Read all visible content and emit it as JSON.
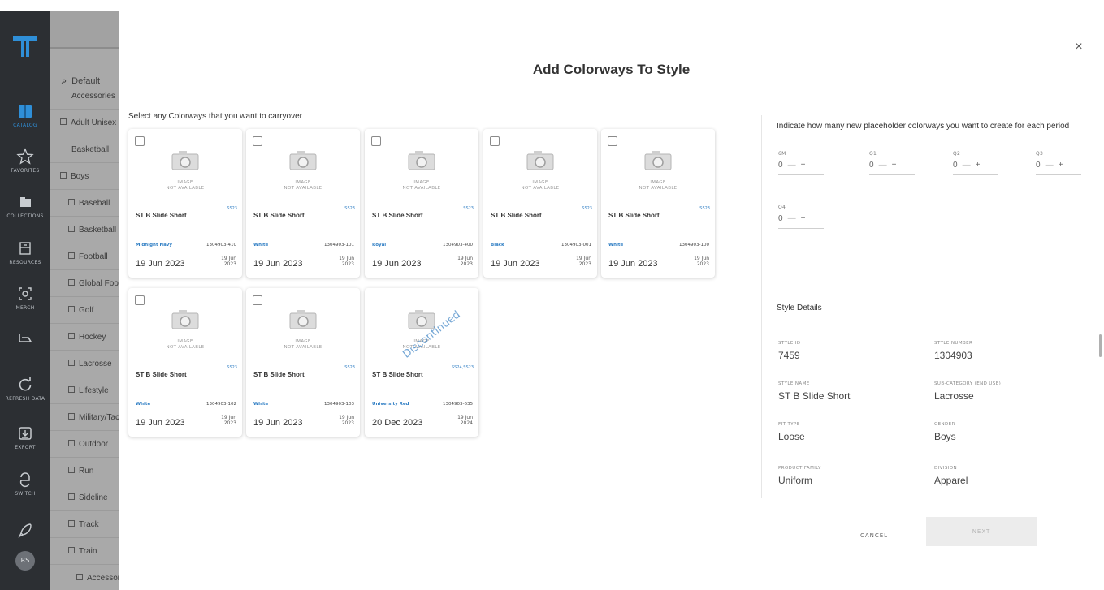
{
  "app": {
    "logo": "under-armour-style-logo"
  },
  "rail": {
    "items": [
      {
        "label": "CATALOG",
        "icon": "book-icon",
        "active": true
      },
      {
        "label": "FAVORITES",
        "icon": "star-icon"
      },
      {
        "label": "COLLECTIONS",
        "icon": "folder-icon"
      },
      {
        "label": "RESOURCES",
        "icon": "resources-icon"
      },
      {
        "label": "MERCH",
        "icon": "merch-icon"
      },
      {
        "label": "",
        "icon": "hanger-icon"
      },
      {
        "label": "REFRESH DATA",
        "icon": "refresh-icon"
      },
      {
        "label": "EXPORT",
        "icon": "export-icon"
      },
      {
        "label": "SWITCH",
        "icon": "switch-icon"
      },
      {
        "label": "",
        "icon": "rocket-icon"
      }
    ],
    "avatar": "RS",
    "accent": "#2f8fd8"
  },
  "category_panel": {
    "search_value": "Default",
    "items": [
      "Accessories",
      "Adult Unisex",
      "Basketball",
      "Boys",
      "Baseball",
      "Basketball",
      "Football",
      "Global Football",
      "Golf",
      "Hockey",
      "Lacrosse",
      "Lifestyle",
      "Military/Tactical",
      "Outdoor",
      "Run",
      "Sideline",
      "Track",
      "Train",
      "Accessories"
    ]
  },
  "dialog": {
    "title": "Add Colorways To Style",
    "instruction": "Select any Colorways that you want to carryover",
    "image_placeholder_line1": "IMAGE",
    "image_placeholder_line2": "NOT AVAILABLE",
    "cards": [
      {
        "name": "ST B Slide Short",
        "season": "SS23",
        "color": "Midnight Navy",
        "number": "1304903-410",
        "date": "19 Jun 2023",
        "small_date_1": "19 Jun",
        "small_date_2": "2023",
        "checked": false,
        "discontinued": false
      },
      {
        "name": "ST B Slide Short",
        "season": "SS23",
        "color": "White",
        "number": "1304903-101",
        "date": "19 Jun 2023",
        "small_date_1": "19 Jun",
        "small_date_2": "2023",
        "checked": false,
        "discontinued": false
      },
      {
        "name": "ST B Slide Short",
        "season": "SS23",
        "color": "Royal",
        "number": "1304903-400",
        "date": "19 Jun 2023",
        "small_date_1": "19 Jun",
        "small_date_2": "2023",
        "checked": false,
        "discontinued": false
      },
      {
        "name": "ST B Slide Short",
        "season": "SS23",
        "color": "Black",
        "number": "1304903-001",
        "date": "19 Jun 2023",
        "small_date_1": "19 Jun",
        "small_date_2": "2023",
        "checked": false,
        "discontinued": false
      },
      {
        "name": "ST B Slide Short",
        "season": "SS23",
        "color": "White",
        "number": "1304903-100",
        "date": "19 Jun 2023",
        "small_date_1": "19 Jun",
        "small_date_2": "2023",
        "checked": false,
        "discontinued": false
      },
      {
        "name": "ST B Slide Short",
        "season": "SS23",
        "color": "White",
        "number": "1304903-102",
        "date": "19 Jun 2023",
        "small_date_1": "19 Jun",
        "small_date_2": "2023",
        "checked": false,
        "discontinued": false
      },
      {
        "name": "ST B Slide Short",
        "season": "SS23",
        "color": "White",
        "number": "1304903-103",
        "date": "19 Jun 2023",
        "small_date_1": "19 Jun",
        "small_date_2": "2023",
        "checked": false,
        "discontinued": false
      },
      {
        "name": "ST B Slide Short",
        "season": "SS24,SS23",
        "color": "University Red",
        "number": "1304903-635",
        "date": "20 Dec 2023",
        "small_date_1": "19 Jun",
        "small_date_2": "2024",
        "checked": false,
        "discontinued": true,
        "discontinued_label": "Discontinued"
      }
    ]
  },
  "placeholder": {
    "instruction": "Indicate how many new placeholder colorways you want to create for each period",
    "periods": [
      {
        "label": "6M",
        "value": "0"
      },
      {
        "label": "Q1",
        "value": "0"
      },
      {
        "label": "Q2",
        "value": "0"
      },
      {
        "label": "Q3",
        "value": "0"
      },
      {
        "label": "Q4",
        "value": "0"
      }
    ],
    "minus": "—",
    "plus": "+"
  },
  "style_details": {
    "title": "Style Details",
    "fields": [
      {
        "key": "STYLE ID",
        "value": "7459"
      },
      {
        "key": "STYLE NUMBER",
        "value": "1304903"
      },
      {
        "key": "STYLE NAME",
        "value": "ST B Slide Short"
      },
      {
        "key": "SUB-CATEGORY (END USE)",
        "value": "Lacrosse"
      },
      {
        "key": "FIT TYPE",
        "value": "Loose"
      },
      {
        "key": "GENDER",
        "value": "Boys"
      },
      {
        "key": "PRODUCT FAMILY",
        "value": "Uniform"
      },
      {
        "key": "DIVISION",
        "value": "Apparel"
      }
    ]
  },
  "actions": {
    "cancel": "CANCEL",
    "next": "NEXT",
    "close": "×"
  }
}
